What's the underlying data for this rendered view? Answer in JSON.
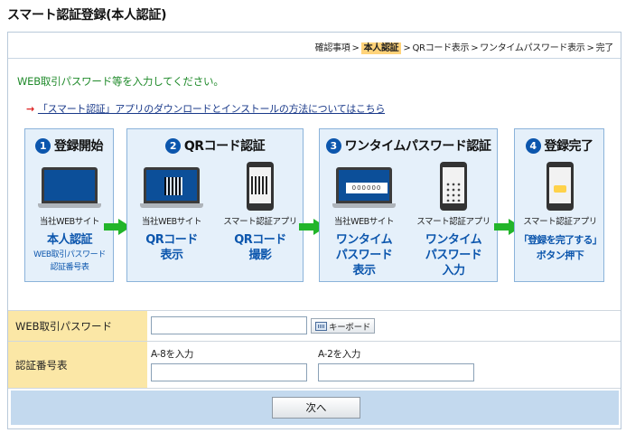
{
  "page": {
    "title": "スマート認証登録(本人認証)"
  },
  "breadcrumb": {
    "items": [
      "確認事項",
      "本人認証",
      "QRコード表示",
      "ワンタイムパスワード表示",
      "完了"
    ],
    "separator": ">"
  },
  "instruction": "WEB取引パスワード等を入力してください。",
  "app_link": "「スマート認証」アプリのダウンロードとインストールの方法についてはこちら",
  "steps": [
    {
      "num": "1",
      "title": "登録開始",
      "cols": [
        {
          "caption": "当社WEBサイト",
          "big": [
            "本人認証"
          ],
          "small": [
            "WEB取引パスワード",
            "認証番号表"
          ]
        }
      ]
    },
    {
      "num": "2",
      "title": "QRコード認証",
      "cols": [
        {
          "caption": "当社WEBサイト",
          "big": [
            "QRコード",
            "表示"
          ]
        },
        {
          "caption": "スマート認証アプリ",
          "big": [
            "QRコード",
            "撮影"
          ]
        }
      ]
    },
    {
      "num": "3",
      "title": "ワンタイムパスワード認証",
      "cols": [
        {
          "caption": "当社WEBサイト",
          "big": [
            "ワンタイム",
            "パスワード",
            "表示"
          ],
          "pw_digits": "000000"
        },
        {
          "caption": "スマート認証アプリ",
          "big": [
            "ワンタイム",
            "パスワード",
            "入力"
          ]
        }
      ]
    },
    {
      "num": "4",
      "title": "登録完了",
      "cols": [
        {
          "caption": "スマート認証アプリ",
          "big": [
            "「登録を完了する」",
            "ボタン押下"
          ]
        }
      ]
    }
  ],
  "form": {
    "password_label": "WEB取引パスワード",
    "password_value": "",
    "keyboard_label": "キーボード",
    "code_label": "認証番号表",
    "code_fields": [
      {
        "label": "A-8を入力",
        "value": ""
      },
      {
        "label": "A-2を入力",
        "value": ""
      }
    ],
    "next_label": "次へ"
  },
  "colors": {
    "accent": "#0c56ad",
    "arrow": "#22b52a",
    "label_bg": "#fbe7a6",
    "bar_bg": "#c3d9ee"
  }
}
